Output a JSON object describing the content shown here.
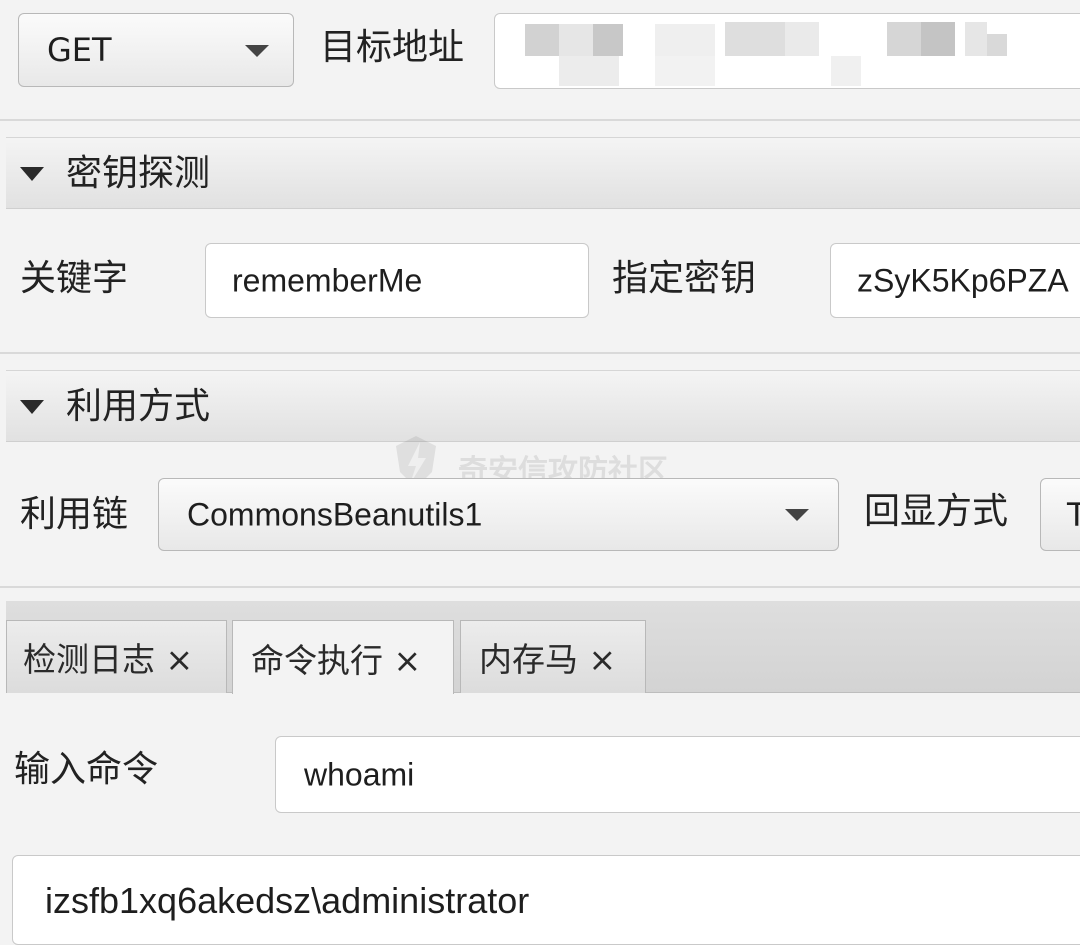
{
  "request": {
    "method": "GET",
    "target_label": "目标地址",
    "target_value": ""
  },
  "key_detect": {
    "header": "密钥探测",
    "keyword_label": "关键字",
    "keyword_value": "rememberMe",
    "key_label": "指定密钥",
    "key_value": "zSyK5Kp6PZA"
  },
  "exploit": {
    "header": "利用方式",
    "chain_label": "利用链",
    "chain_value": "CommonsBeanutils1",
    "echo_label": "回显方式",
    "echo_value": "T"
  },
  "watermark": "奇安信攻防社区",
  "tabs": [
    {
      "label": "检测日志 ×"
    },
    {
      "label": "命令执行 ×"
    },
    {
      "label": "内存马 ×"
    }
  ],
  "command": {
    "label": "输入命令",
    "value": "whoami"
  },
  "output": {
    "text": "izsfb1xq6akedsz\\administrator"
  }
}
